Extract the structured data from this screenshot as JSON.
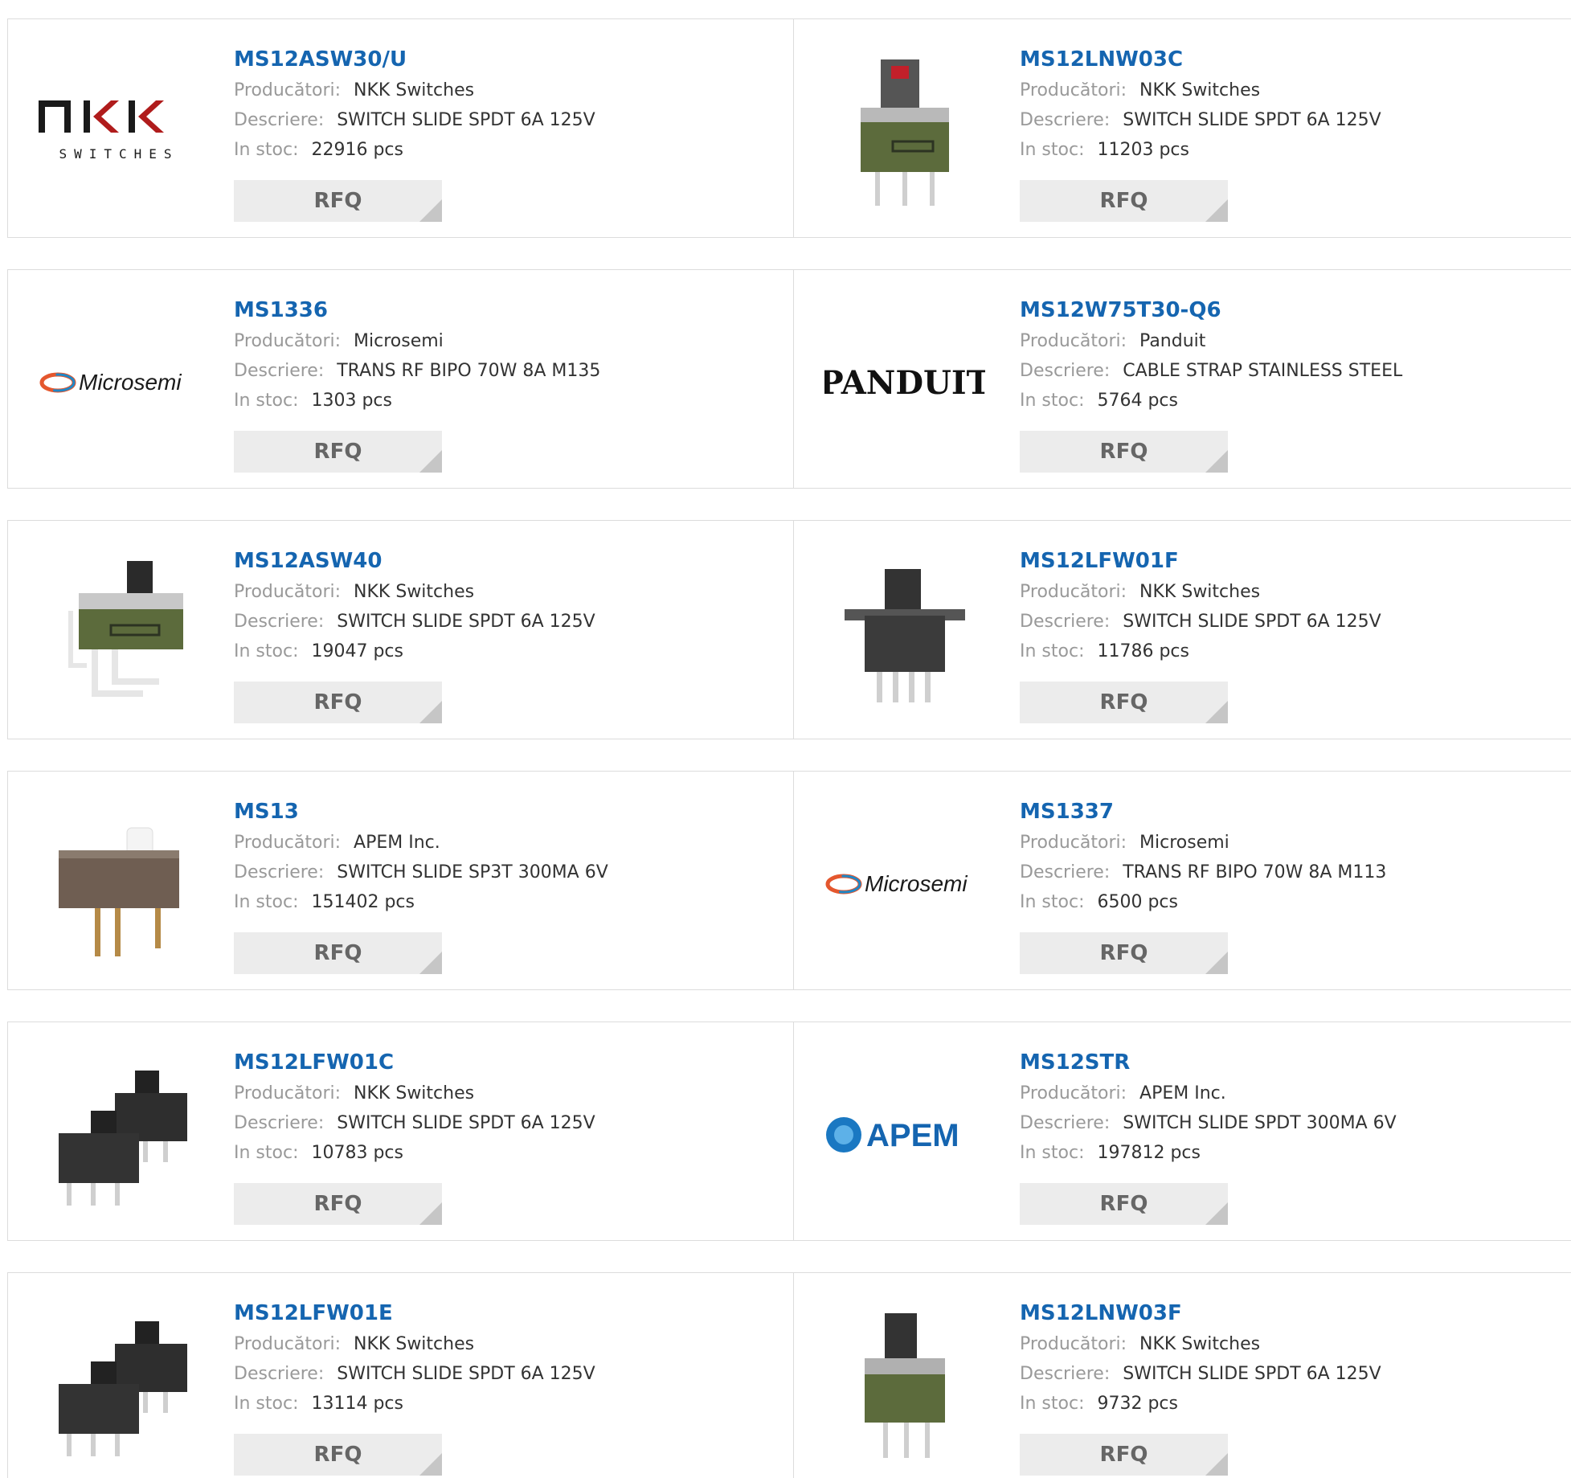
{
  "labels": {
    "manufacturer": "Producători:",
    "description": "Descriere:",
    "stock": "In stoc:",
    "rfq": "RFQ"
  },
  "colors": {
    "part_link": "#1565b0",
    "label": "#999999",
    "value": "#333333",
    "rfq_bg": "#ececec",
    "border": "#dcdcdc"
  },
  "rows": [
    {
      "left": {
        "part": "MS12ASW30/U",
        "manufacturer": "NKK Switches",
        "description": "SWITCH SLIDE SPDT 6A 125V",
        "stock": "22916 pcs",
        "image": "nkk-logo",
        "logo_text": "NKK",
        "logo_sub": "SWITCHES"
      },
      "right": {
        "part": "MS12LNW03C",
        "manufacturer": "NKK Switches",
        "description": "SWITCH SLIDE SPDT 6A 125V",
        "stock": "11203 pcs",
        "image": "slide-switch-photo"
      }
    },
    {
      "left": {
        "part": "MS1336",
        "manufacturer": "Microsemi",
        "description": "TRANS RF BIPO 70W 8A M135",
        "stock": "1303 pcs",
        "image": "microsemi-logo",
        "logo_text": "Microsemi"
      },
      "right": {
        "part": "MS12W75T30-Q6",
        "manufacturer": "Panduit",
        "description": "CABLE STRAP STAINLESS STEEL",
        "stock": "5764 pcs",
        "image": "panduit-logo",
        "logo_text": "PANDUIT"
      }
    },
    {
      "left": {
        "part": "MS12ASW40",
        "manufacturer": "NKK Switches",
        "description": "SWITCH SLIDE SPDT 6A 125V",
        "stock": "19047 pcs",
        "image": "slide-switch-photo"
      },
      "right": {
        "part": "MS12LFW01F",
        "manufacturer": "NKK Switches",
        "description": "SWITCH SLIDE SPDT 6A 125V",
        "stock": "11786 pcs",
        "image": "slide-switch-photo"
      }
    },
    {
      "left": {
        "part": "MS13",
        "manufacturer": "APEM Inc.",
        "description": "SWITCH SLIDE SP3T 300MA 6V",
        "stock": "151402 pcs",
        "image": "slide-switch-photo"
      },
      "right": {
        "part": "MS1337",
        "manufacturer": "Microsemi",
        "description": "TRANS RF BIPO 70W 8A M113",
        "stock": "6500 pcs",
        "image": "microsemi-logo",
        "logo_text": "Microsemi"
      }
    },
    {
      "left": {
        "part": "MS12LFW01C",
        "manufacturer": "NKK Switches",
        "description": "SWITCH SLIDE SPDT 6A 125V",
        "stock": "10783 pcs",
        "image": "slide-switch-photo"
      },
      "right": {
        "part": "MS12STR",
        "manufacturer": "APEM Inc.",
        "description": "SWITCH SLIDE SPDT 300MA 6V",
        "stock": "197812 pcs",
        "image": "apem-logo",
        "logo_text": "APEM"
      }
    },
    {
      "left": {
        "part": "MS12LFW01E",
        "manufacturer": "NKK Switches",
        "description": "SWITCH SLIDE SPDT 6A 125V",
        "stock": "13114 pcs",
        "image": "slide-switch-photo"
      },
      "right": {
        "part": "MS12LNW03F",
        "manufacturer": "NKK Switches",
        "description": "SWITCH SLIDE SPDT 6A 125V",
        "stock": "9732 pcs",
        "image": "slide-switch-photo"
      }
    }
  ]
}
